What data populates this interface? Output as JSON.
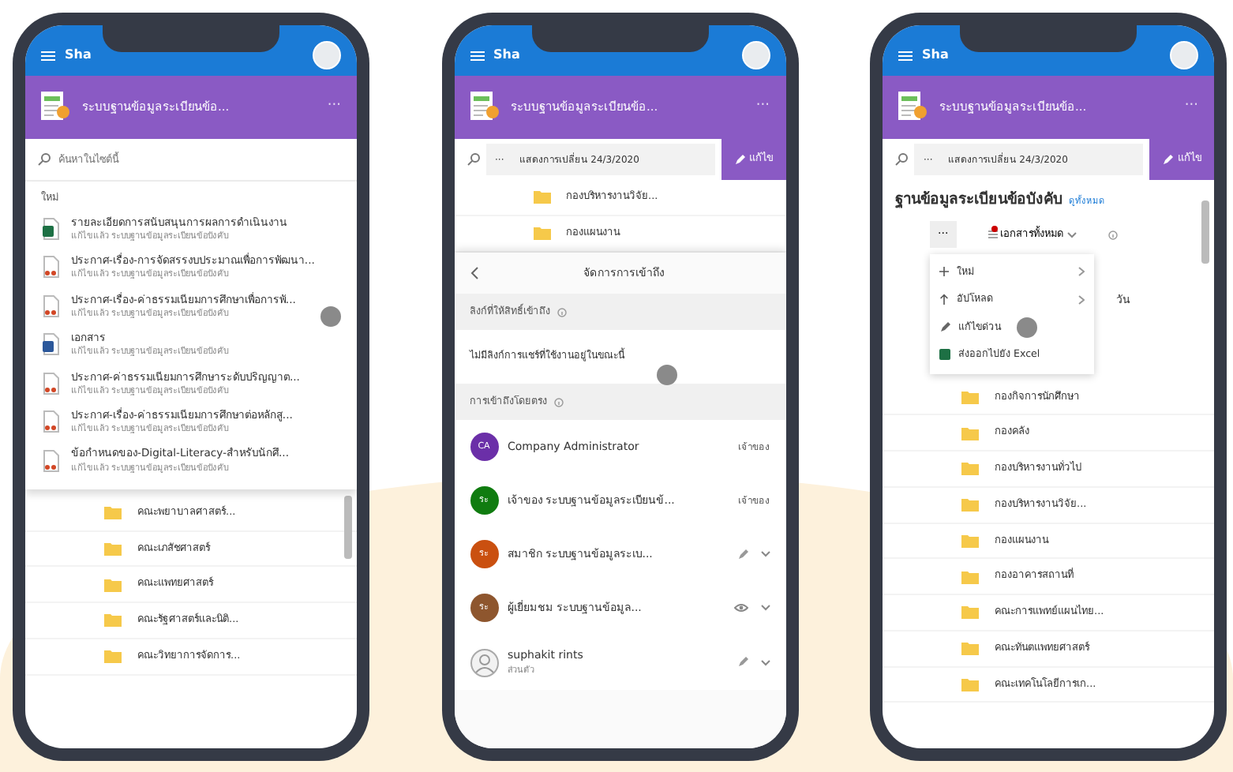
{
  "phones": [
    {
      "kind": "recent",
      "app_title": "Sha",
      "site_title": "ระบบฐานข้อมูลระเบียนข้อ...",
      "site_menu": "···",
      "search": {
        "placeholder": "ค้นหาในไซต์นี้"
      },
      "section": "ใหม่",
      "files": [
        {
          "kind": "excel",
          "name": "รายละเอียดการสนับสนุนการผลการดำเนินงาน",
          "meta": "แก้ไขแล้ว ระบบฐานข้อมูลระเบียนข้อบังคับ"
        },
        {
          "kind": "pdf",
          "name": "ประกาศ-เรื่อง-การจัดสรรงบประมาณเพื่อการพัฒนา...",
          "meta": "แก้ไขแล้ว ระบบฐานข้อมูลระเบียนข้อบังคับ"
        },
        {
          "kind": "pdf",
          "name": "ประกาศ-เรื่อง-ค่าธรรมเนียมการศึกษาเพื่อการพั...",
          "meta": "แก้ไขแล้ว ระบบฐานข้อมูลระเบียนข้อบังคับ"
        },
        {
          "kind": "word",
          "name": "เอกสาร",
          "meta": "แก้ไขแล้ว ระบบฐานข้อมูลระเบียนข้อบังคับ"
        },
        {
          "kind": "pdf",
          "name": "ประกาศ-ค่าธรรมเนียมการศึกษาระดับปริญญาต...",
          "meta": "แก้ไขแล้ว ระบบฐานข้อมูลระเบียนข้อบังคับ"
        },
        {
          "kind": "pdf",
          "name": "ประกาศ-เรื่อง-ค่าธรรมเนียมการศึกษาต่อหลักสู...",
          "meta": "แก้ไขแล้ว ระบบฐานข้อมูลระเบียนข้อบังคับ"
        },
        {
          "kind": "pdf",
          "name": "ข้อกำหนดของ-Digital-Literacy-สำหรับนักศึ...",
          "meta": "แก้ไขแล้ว ระบบฐานข้อมูลระเบียนข้อบังคับ"
        }
      ],
      "folders": [
        "คณะพยาบาลศาสตร์...",
        "คณะเภสัชศาสตร์",
        "คณะแพทยศาสตร์",
        "คณะรัฐศาสตร์และนิติ...",
        "คณะวิทยาการจัดการ..."
      ]
    },
    {
      "kind": "access",
      "app_title": "Sha",
      "site_title": "ระบบฐานข้อมูลระเบียนข้อ...",
      "site_menu": "···",
      "more": "···",
      "breadcrumb": "แสดงการเปลี่ยน 24/3/2020",
      "edit": "แก้ไข",
      "folders": [
        "กองบริหารงานวิจัย...",
        "กองแผนงาน"
      ],
      "panel": {
        "title": "จัดการการเข้าถึง",
        "links_heading": "ลิงก์ที่ให้สิทธิ์เข้าถึง",
        "links_note": "ไม่มีลิงก์การแชร์ที่ใช้งานอยู่ในขณะนี้",
        "direct_heading": "การเข้าถึงโดยตรง",
        "people": [
          {
            "initials": "CA",
            "name": "Company Administrator",
            "kind": "role",
            "role": "เจ้าของ",
            "color": "#6b2fa8"
          },
          {
            "initials": "ระ",
            "name": "เจ้าของ ระบบฐานข้อมูลระเบียนข้...",
            "kind": "role",
            "role": "เจ้าของ",
            "color": "#107c10"
          },
          {
            "initials": "ระ",
            "name": "สมาชิก ระบบฐานข้อมูลระเบ...",
            "kind": "edit",
            "color": "#ca5010"
          },
          {
            "initials": "ระ",
            "name": "ผู้เยี่ยมชม ระบบฐานข้อมูล...",
            "kind": "view",
            "color": "#8e562e"
          },
          {
            "name": "suphakit rints",
            "sub": "ส่วนตัว",
            "kind": "edit"
          }
        ]
      }
    },
    {
      "kind": "library",
      "app_title": "Sha",
      "site_title": "ระบบฐานข้อมูลระเบียนข้อ...",
      "site_menu": "···",
      "more": "···",
      "breadcrumb": "แสดงการเปลี่ยน 24/3/2020",
      "edit": "แก้ไข",
      "title": "ฐานข้อมูลระเบียนข้อบังคับ",
      "see_all": "ดูทั้งหมด",
      "toolbar_more": "···",
      "view": "เอกสารทั้งหมด",
      "column": "วัน",
      "menu": [
        {
          "kind": "new",
          "label": "ใหม่",
          "submenu": true
        },
        {
          "kind": "upload",
          "label": "อัปโหลด",
          "submenu": true
        },
        {
          "kind": "quickedit",
          "label": "แก้ไขด่วน",
          "submenu": false
        },
        {
          "kind": "excel",
          "label": "ส่งออกไปยัง Excel",
          "submenu": false
        }
      ],
      "folders": [
        "กองกิจการนักศึกษา",
        "กองคลัง",
        "กองบริหารงานทั่วไป",
        "กองบริหารงานวิจัย...",
        "กองแผนงาน",
        "กองอาคารสถานที่",
        "คณะการแพทย์แผนไทย...",
        "คณะทันตแพทยศาสตร์",
        "คณะเทคโนโลยีการเก..."
      ]
    }
  ]
}
